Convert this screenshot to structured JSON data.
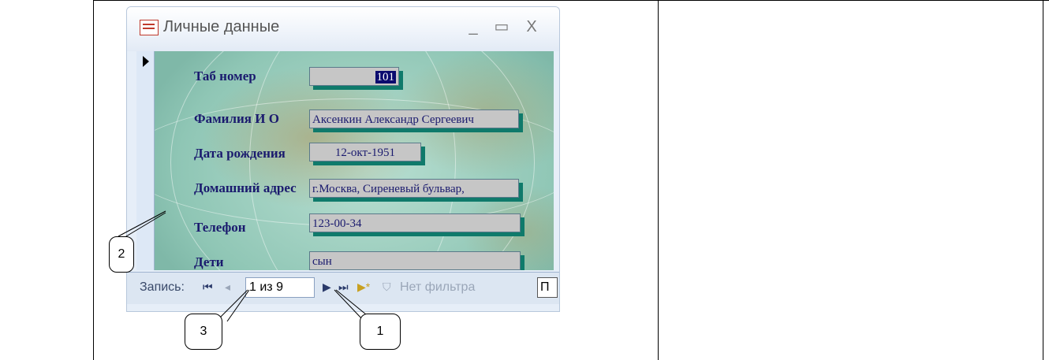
{
  "window": {
    "title": "Личные данные",
    "controls": {
      "minimize": "_",
      "maximize": "▭",
      "close": "X"
    }
  },
  "form": {
    "fields": [
      {
        "label": "Таб номер",
        "value": "101"
      },
      {
        "label": "Фамилия И О",
        "value": "Аксенкин Александр Сергеевич"
      },
      {
        "label": "Дата рождения",
        "value": "12-окт-1951"
      },
      {
        "label": "Домашний адрес",
        "value": "г.Москва, Сиреневый бульвар,"
      },
      {
        "label": "Телефон",
        "value": "123-00-34"
      },
      {
        "label": "Дети",
        "value": "сын"
      }
    ]
  },
  "navigation": {
    "record_label": "Запись:",
    "first_icon": "⏮",
    "prev_icon": "◂",
    "counter": "1 из 9",
    "next_icon": "▶",
    "last_icon": "⏭",
    "new_icon": "▶*",
    "filter_icon": "⛉",
    "filter_text": "Нет фильтра",
    "search_partial": "П"
  },
  "callouts": [
    {
      "label": "1"
    },
    {
      "label": "2"
    },
    {
      "label": "3"
    }
  ]
}
